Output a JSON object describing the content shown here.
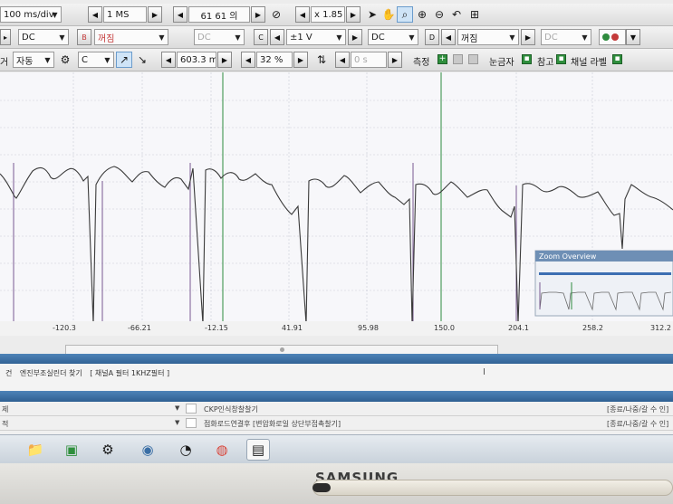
{
  "toolbar1": {
    "time_div": "100 ms/div",
    "record_interval": "1 MS",
    "frame_counter": "61 61 의",
    "zoom_factor": "x 1.85"
  },
  "toolbar2": {
    "channel_a_coupling": "DC",
    "channel_b_label": "B",
    "channel_b_state": "꺼짐",
    "channel_b_coupling": "DC",
    "channel_c_label": "C",
    "channel_c_range": "±1 V",
    "channel_c_coupling": "DC",
    "channel_d_label": "D",
    "channel_d_state": "꺼짐",
    "channel_d_coupling": "DC"
  },
  "toolbar3": {
    "trigger_label": "거",
    "trigger_mode": "자동",
    "trigger_channel": "C",
    "trigger_level": "603.3 mV",
    "pretrigger": "32 %",
    "delay": "0 s",
    "measure_label": "측정",
    "ruler_label": "눈금자",
    "reference_label": "참고",
    "channel_label_label": "채널 라벨"
  },
  "axis_ticks": [
    "-120.3",
    "-66.21",
    "-12.15",
    "41.91",
    "95.98",
    "150.0",
    "204.1",
    "258.2",
    "312.2"
  ],
  "zoom_overview": {
    "title": "Zoom Overview"
  },
  "info": {
    "prefix": "건",
    "text": "엔진부조실린더 찾기",
    "note": "[ 채널A 필터 1KHZ필터 ]"
  },
  "tasks": [
    {
      "left": "제",
      "text": "CKP인식창찰찰기",
      "right": "[종료/나중/갈 수 인]"
    },
    {
      "left": "적",
      "text": "점화로드연결후 [변압화로일 상단부접촉찰기]",
      "right": "[종료/나중/갈 수 인]"
    }
  ],
  "device": {
    "brand": "SAMSUNG"
  },
  "colors": {
    "trace": "#3a3a3a",
    "cursor_purple": "#7a5a92",
    "cursor_green": "#2e8b3e",
    "panel_blue": "#3a6ea5"
  }
}
